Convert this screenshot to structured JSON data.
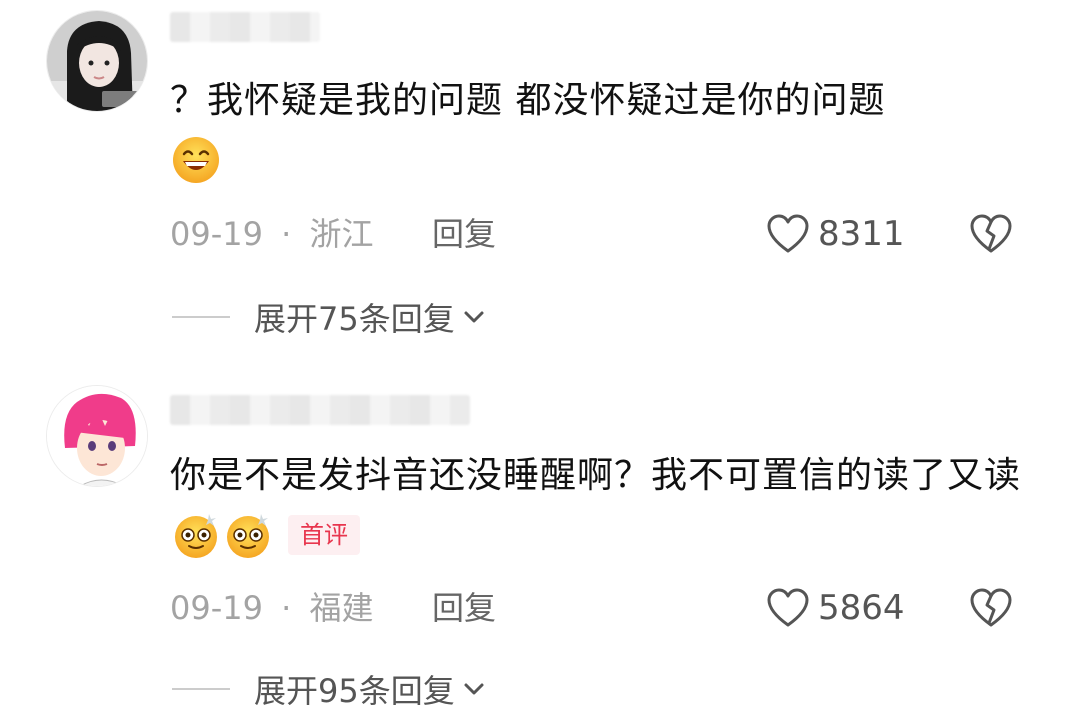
{
  "comments": [
    {
      "avatar_icon": "avatar-girl-photo",
      "text": "？我怀疑是我的问题 都没怀疑过是你的问题",
      "emojis": [
        "grin-emoji"
      ],
      "date": "09-19",
      "separator": "·",
      "location": "浙江",
      "reply_label": "回复",
      "like_count": "8311",
      "expand_label": "展开75条回复"
    },
    {
      "avatar_icon": "avatar-pink-hair-anime",
      "text": "你是不是发抖音还没睡醒啊？我不可置信的读了又读",
      "emojis": [
        "dizzy-emoji",
        "dizzy-emoji"
      ],
      "badge": "首评",
      "date": "09-19",
      "separator": "·",
      "location": "福建",
      "reply_label": "回复",
      "like_count": "5864",
      "expand_label": "展开95条回复"
    }
  ],
  "colors": {
    "text": "#111111",
    "meta": "#a3a3a3",
    "badge": "#e8364e",
    "badge_bg": "#fdeff1"
  }
}
